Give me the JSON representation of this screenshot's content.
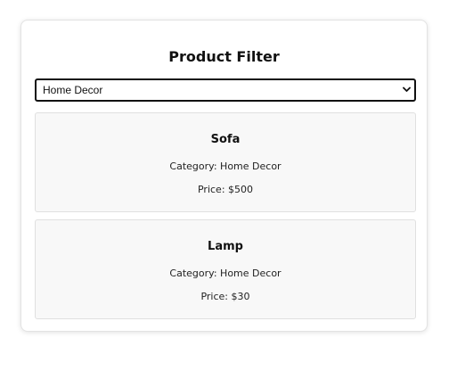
{
  "page": {
    "title": "Product Filter"
  },
  "filter": {
    "selected": "Home Decor",
    "icon": "chevron-down-icon"
  },
  "products": [
    {
      "name": "Sofa",
      "category": "Category: Home Decor",
      "price": "Price: $500"
    },
    {
      "name": "Lamp",
      "category": "Category: Home Decor",
      "price": "Price: $30"
    }
  ],
  "colors": {
    "card_background": "#f8f8f8",
    "select_border": "#111111",
    "panel_border": "#e3e3e3"
  }
}
